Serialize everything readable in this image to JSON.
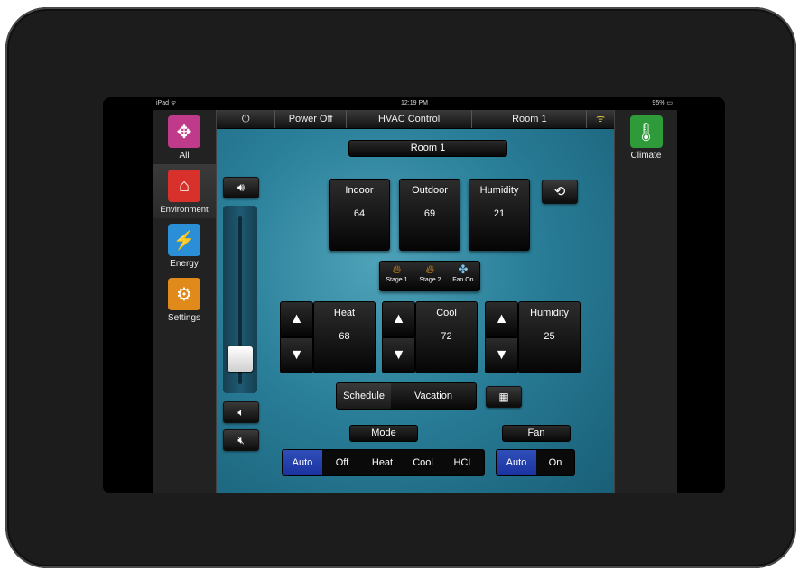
{
  "status_bar": {
    "device": "iPad ᯤ",
    "time": "12:19 PM",
    "battery": "95% ▭"
  },
  "nav": {
    "items": [
      {
        "label": "All",
        "icon": "compass-icon",
        "color": "#c03a8a"
      },
      {
        "label": "Environment",
        "icon": "house-icon",
        "color": "#d8302b"
      },
      {
        "label": "Energy",
        "icon": "plug-icon",
        "color": "#2a8fd6"
      },
      {
        "label": "Settings",
        "icon": "gears-icon",
        "color": "#e08a1c"
      }
    ]
  },
  "right_nav": {
    "label": "Climate",
    "icon": "thermometer-icon",
    "color": "#2e9a3a"
  },
  "topbar": {
    "power_icon": "⏻",
    "power": "Power Off",
    "title": "HVAC Control",
    "room": "Room 1",
    "signal_icon": "ᯤ"
  },
  "room_label": "Room 1",
  "readings": {
    "indoor": {
      "label": "Indoor",
      "value": "64"
    },
    "outdoor": {
      "label": "Outdoor",
      "value": "69"
    },
    "humidity": {
      "label": "Humidity",
      "value": "21"
    }
  },
  "stages": [
    {
      "label": "Stage 1",
      "icon": "flame-icon"
    },
    {
      "label": "Stage 2",
      "icon": "flame-icon"
    },
    {
      "label": "Fan On",
      "icon": "fan-icon"
    }
  ],
  "setpoints": {
    "heat": {
      "label": "Heat",
      "value": "68"
    },
    "cool": {
      "label": "Cool",
      "value": "72"
    },
    "humidity": {
      "label": "Humidity",
      "value": "25"
    }
  },
  "schedule": {
    "schedule_label": "Schedule",
    "vacation_label": "Vacation"
  },
  "mode": {
    "label": "Mode",
    "options": [
      "Auto",
      "Off",
      "Heat",
      "Cool",
      "HCL"
    ],
    "selected": "Auto"
  },
  "fan": {
    "label": "Fan",
    "options": [
      "Auto",
      "On"
    ],
    "selected": "Auto"
  },
  "volume": {
    "level": 0.1
  },
  "colors": {
    "accent": "#1f3aa8",
    "background": "#2a7f99"
  }
}
